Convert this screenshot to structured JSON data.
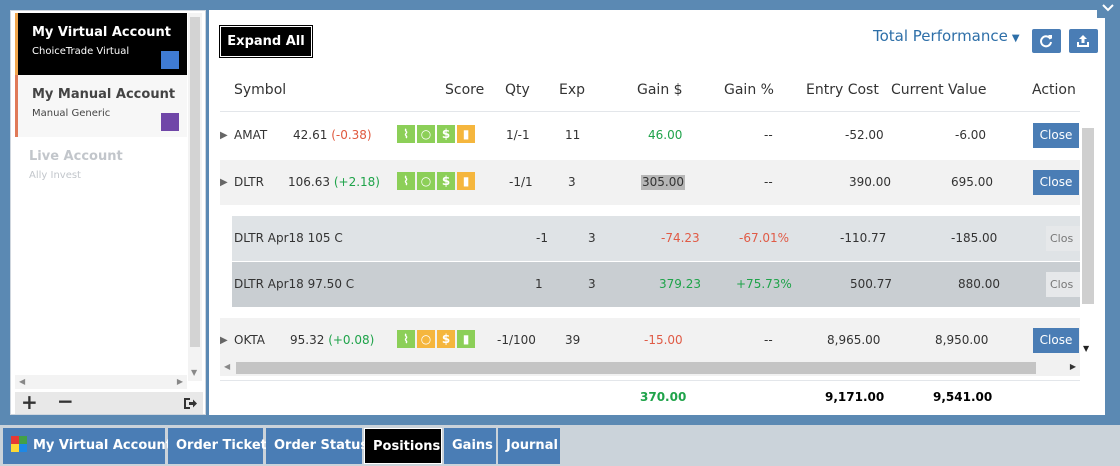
{
  "sidebar": {
    "accounts": [
      {
        "name": "My Virtual Account",
        "subtitle": "ChoiceTrade Virtual",
        "color": "#3f7bd4"
      },
      {
        "name": "My Manual Account",
        "subtitle": "Manual Generic",
        "color": "#7047a8"
      },
      {
        "name": "Live Account",
        "subtitle": "Ally Invest"
      }
    ],
    "add_label": "+",
    "remove_label": "−"
  },
  "toolbar": {
    "expand_all": "Expand All",
    "performance": "Total Performance"
  },
  "columns": [
    "Symbol",
    "Score",
    "Qty",
    "Exp",
    "Gain $",
    "Gain %",
    "Entry Cost",
    "Current Value",
    "Action"
  ],
  "positions": [
    {
      "symbol": "AMAT",
      "price": "42.61",
      "change": "(-0.38)",
      "qty": "1/-1",
      "exp": "11",
      "gain": "46.00",
      "gain_pct": "--",
      "entry_cost": "-52.00",
      "current_value": "-6.00",
      "action": "Close"
    },
    {
      "symbol": "DLTR",
      "price": "106.63",
      "change": "(+2.18)",
      "qty": "-1/1",
      "exp": "3",
      "gain": "305.00",
      "gain_pct": "--",
      "entry_cost": "390.00",
      "current_value": "695.00",
      "action": "Close"
    },
    {
      "symbol": "OKTA",
      "price": "95.32",
      "change": "(+0.08)",
      "qty": "-1/100",
      "exp": "39",
      "gain": "-15.00",
      "gain_pct": "--",
      "entry_cost": "8,965.00",
      "current_value": "8,950.00",
      "action": "Close"
    }
  ],
  "legs": [
    {
      "symbol": "DLTR Apr18 105 C",
      "qty": "-1",
      "exp": "3",
      "gain": "-74.23",
      "gain_pct": "-67.01%",
      "entry_cost": "-110.77",
      "current_value": "-185.00",
      "action": "Clos"
    },
    {
      "symbol": "DLTR Apr18 97.50 C",
      "qty": "1",
      "exp": "3",
      "gain": "379.23",
      "gain_pct": "+75.73%",
      "entry_cost": "500.77",
      "current_value": "880.00",
      "action": "Clos"
    }
  ],
  "totals": {
    "gain": "370.00",
    "entry_cost": "9,171.00",
    "current_value": "9,541.00"
  },
  "tabs": [
    "My Virtual Account",
    "Order Ticket",
    "Order Status",
    "Positions",
    "Gains",
    "Journal"
  ],
  "active_tab": "Positions",
  "colors": {
    "accent": "#4a7db5",
    "positive": "#1fa34a",
    "negative": "#e0593e",
    "score_green": "#8ccf58",
    "score_orange": "#f5b63d"
  },
  "icons": {
    "score": [
      "chart-icon",
      "circle-icon",
      "dollar-icon",
      "bars-icon"
    ],
    "refresh": "refresh-icon",
    "export": "export-icon",
    "exit": "exit-icon"
  }
}
